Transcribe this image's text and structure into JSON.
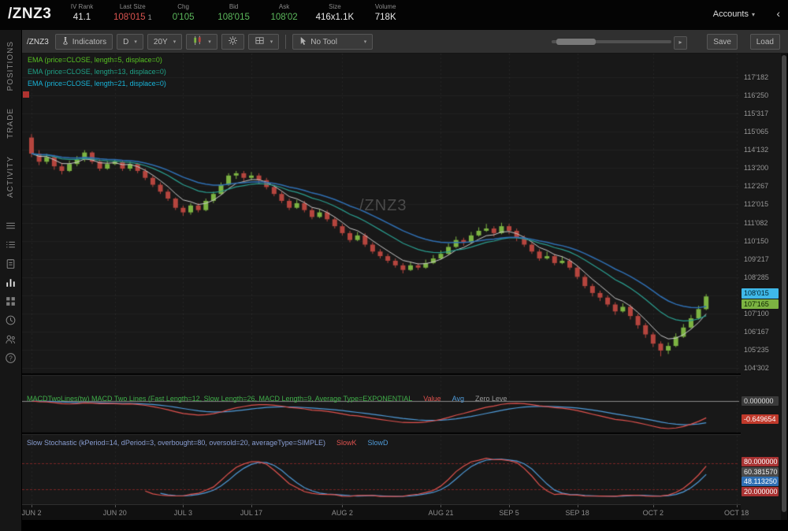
{
  "header": {
    "symbol": "/ZNZ3",
    "stats": [
      {
        "label": "IV Rank",
        "value": "41.1",
        "color": "white"
      },
      {
        "label": "Last Size",
        "value": "108'015",
        "suffix": "1",
        "color": "red"
      },
      {
        "label": "Chg",
        "value": "0'105",
        "color": "green"
      },
      {
        "label": "Bid",
        "value": "108'015",
        "color": "green"
      },
      {
        "label": "Ask",
        "value": "108'02",
        "color": "green"
      },
      {
        "label": "Size",
        "value": "416x1.1K",
        "color": "white"
      },
      {
        "label": "Volume",
        "value": "718K",
        "color": "white"
      }
    ],
    "accounts_label": "Accounts"
  },
  "toolbar": {
    "symbol_chip": "/ZNZ3",
    "indicators_label": "Indicators",
    "timeframe_value": "D",
    "range_value": "20Y",
    "tool_value": "No Tool",
    "save_label": "Save",
    "load_label": "Load"
  },
  "sidebar": {
    "tabs": [
      "POSITIONS",
      "TRADE",
      "ACTIVITY"
    ],
    "icons": [
      {
        "name": "menu-rows-icon"
      },
      {
        "name": "watchlist-icon"
      },
      {
        "name": "orders-clipboard-icon"
      },
      {
        "name": "chart-icon",
        "active": true
      },
      {
        "name": "apps-grid-icon"
      },
      {
        "name": "history-clock-icon"
      },
      {
        "name": "followers-users-icon"
      },
      {
        "name": "help-icon"
      }
    ]
  },
  "chart": {
    "watermark": "/ZNZ3",
    "ema_labels": [
      {
        "text": "EMA (price=CLOSE, length=5, displace=0)",
        "color": "#56c022"
      },
      {
        "text": "EMA (price=CLOSE, length=13, displace=0)",
        "color": "#1fa187"
      },
      {
        "text": "EMA (price=CLOSE, length=21, displace=0)",
        "color": "#18b4d8"
      }
    ],
    "price_axis_labels": [
      "117'182",
      "116'250",
      "115'317",
      "115'065",
      "114'132",
      "113'200",
      "112'267",
      "112'015",
      "111'082",
      "110'150",
      "109'217",
      "108'285",
      "107'100",
      "106'167",
      "105'235",
      "104'302"
    ],
    "last_price_box": {
      "text": "108'015",
      "bg": "#3fb8e8",
      "fg": "#00222e"
    },
    "close_price_box": {
      "text": "107'165",
      "bg": "#7cb342",
      "fg": "#0c2200"
    },
    "time_axis": [
      {
        "label": "JUN 2",
        "day": 0
      },
      {
        "label": "JUN 20",
        "day": 11
      },
      {
        "label": "JUL 3",
        "day": 20
      },
      {
        "label": "JUL 17",
        "day": 29
      },
      {
        "label": "AUG 2",
        "day": 41
      },
      {
        "label": "AUG 21",
        "day": 54
      },
      {
        "label": "SEP 5",
        "day": 63
      },
      {
        "label": "SEP 18",
        "day": 72
      },
      {
        "label": "OCT 2",
        "day": 82
      },
      {
        "label": "OCT 18",
        "day": 93
      }
    ]
  },
  "macd": {
    "label": "MACDTwoLines(tw) MACD Two Lines (Fast Length=12, Slow Length=26, MACD Length=9, Average Type=EXPONENTIAL",
    "legend": [
      {
        "text": "Value",
        "color": "#e0524e"
      },
      {
        "text": "Avg",
        "color": "#4f9bd9"
      },
      {
        "text": "Zero Leve",
        "color": "#9a9a9a"
      }
    ],
    "zero_box": "0.000000",
    "value_box": "-0.649654"
  },
  "stochastic": {
    "label": "Slow Stochastic (kPeriod=14, dPeriod=3, overbought=80, oversold=20, averageType=SIMPLE)",
    "legend": [
      {
        "text": "SlowK",
        "color": "#e0524e"
      },
      {
        "text": "SlowD",
        "color": "#4f9bd9"
      }
    ],
    "boxes": [
      {
        "text": "80.000000",
        "bg": "#a83232",
        "fg": "#ffffff"
      },
      {
        "text": "60.381570",
        "bg": "#4a4a4a",
        "fg": "#eeeeee"
      },
      {
        "text": "48.113250",
        "bg": "#2f6fb3",
        "fg": "#ffffff"
      },
      {
        "text": "20.000000",
        "bg": "#a83232",
        "fg": "#ffffff"
      }
    ]
  },
  "chart_data": {
    "type": "candlestick",
    "symbol": "/ZNZ3",
    "timeframe": "D",
    "price_min": 104.944,
    "price_max": 117.57,
    "up_color": "#7cb342",
    "down_color": "#b5453e",
    "indicators": {
      "ema": {
        "lengths": [
          5,
          13,
          21
        ],
        "colors": [
          "#c9c9c9",
          "#2a9d8f",
          "#2f6fb3"
        ]
      },
      "macd": {
        "fast": 12,
        "slow": 26,
        "signal": 9,
        "value_color": "#e0524e",
        "avg_color": "#4f9bd9"
      },
      "stochastic": {
        "k_period": 14,
        "d_period": 3,
        "overbought": 80,
        "oversold": 20,
        "k_color": "#e0524e",
        "d_color": "#4f9bd9"
      }
    },
    "candles": [
      [
        114.95,
        115.1,
        114.1,
        114.25
      ],
      [
        114.25,
        114.4,
        113.75,
        113.9
      ],
      [
        113.9,
        114.25,
        113.8,
        114.1
      ],
      [
        114.1,
        114.2,
        113.55,
        113.7
      ],
      [
        113.7,
        113.85,
        113.35,
        113.5
      ],
      [
        113.5,
        113.95,
        113.45,
        113.8
      ],
      [
        113.8,
        114.15,
        113.7,
        114.0
      ],
      [
        114.0,
        114.4,
        113.9,
        114.3
      ],
      [
        114.3,
        114.35,
        113.8,
        113.9
      ],
      [
        113.9,
        114.0,
        113.5,
        113.6
      ],
      [
        113.6,
        113.95,
        113.55,
        113.8
      ],
      [
        113.8,
        114.0,
        113.75,
        113.9
      ],
      [
        113.9,
        113.95,
        113.5,
        113.6
      ],
      [
        113.6,
        113.9,
        113.5,
        113.8
      ],
      [
        113.8,
        113.85,
        113.4,
        113.5
      ],
      [
        113.5,
        113.6,
        113.1,
        113.2
      ],
      [
        113.2,
        113.3,
        112.8,
        112.9
      ],
      [
        112.9,
        113.0,
        112.5,
        112.6
      ],
      [
        112.6,
        112.7,
        112.2,
        112.3
      ],
      [
        112.3,
        112.35,
        111.8,
        111.9
      ],
      [
        111.9,
        112.0,
        111.55,
        111.7
      ],
      [
        111.7,
        112.1,
        111.6,
        112.0
      ],
      [
        112.0,
        112.1,
        111.7,
        111.8
      ],
      [
        111.8,
        112.3,
        111.75,
        112.2
      ],
      [
        112.2,
        112.6,
        112.1,
        112.5
      ],
      [
        112.5,
        113.0,
        112.45,
        112.9
      ],
      [
        112.9,
        113.4,
        112.85,
        113.3
      ],
      [
        113.3,
        113.5,
        113.15,
        113.4
      ],
      [
        113.4,
        113.5,
        113.05,
        113.2
      ],
      [
        113.2,
        113.45,
        113.1,
        113.3
      ],
      [
        113.3,
        113.4,
        112.95,
        113.1
      ],
      [
        113.1,
        113.2,
        112.7,
        112.8
      ],
      [
        112.8,
        112.9,
        112.4,
        112.5
      ],
      [
        112.5,
        112.6,
        112.1,
        112.2
      ],
      [
        112.2,
        112.3,
        111.8,
        111.9
      ],
      [
        111.9,
        112.25,
        111.85,
        112.1
      ],
      [
        112.1,
        112.2,
        111.7,
        111.8
      ],
      [
        111.8,
        111.9,
        111.4,
        111.5
      ],
      [
        111.5,
        111.85,
        111.45,
        111.7
      ],
      [
        111.7,
        111.8,
        111.3,
        111.4
      ],
      [
        111.4,
        111.5,
        111.0,
        111.1
      ],
      [
        111.1,
        111.2,
        110.7,
        110.8
      ],
      [
        110.8,
        110.9,
        110.4,
        110.5
      ],
      [
        110.5,
        110.85,
        110.45,
        110.7
      ],
      [
        110.7,
        110.8,
        110.2,
        110.3
      ],
      [
        110.3,
        110.4,
        109.9,
        110.0
      ],
      [
        110.0,
        110.1,
        109.7,
        109.8
      ],
      [
        109.8,
        109.9,
        109.5,
        109.6
      ],
      [
        109.6,
        109.7,
        109.3,
        109.4
      ],
      [
        109.4,
        109.5,
        109.05,
        109.2
      ],
      [
        109.2,
        109.55,
        109.15,
        109.4
      ],
      [
        109.4,
        109.5,
        109.2,
        109.3
      ],
      [
        109.3,
        109.65,
        109.25,
        109.5
      ],
      [
        109.5,
        109.85,
        109.45,
        109.7
      ],
      [
        109.7,
        110.05,
        109.65,
        109.9
      ],
      [
        109.9,
        110.35,
        109.85,
        110.2
      ],
      [
        110.2,
        110.65,
        110.15,
        110.5
      ],
      [
        110.5,
        110.6,
        110.25,
        110.4
      ],
      [
        110.4,
        110.85,
        110.35,
        110.7
      ],
      [
        110.7,
        111.05,
        110.65,
        110.9
      ],
      [
        110.9,
        111.2,
        110.85,
        111.0
      ],
      [
        111.0,
        111.1,
        110.65,
        110.8
      ],
      [
        110.8,
        111.25,
        110.75,
        111.1
      ],
      [
        111.1,
        111.2,
        110.75,
        110.9
      ],
      [
        110.9,
        111.0,
        110.45,
        110.6
      ],
      [
        110.6,
        110.7,
        110.2,
        110.3
      ],
      [
        110.3,
        110.4,
        109.9,
        110.0
      ],
      [
        110.0,
        110.1,
        109.6,
        109.7
      ],
      [
        109.7,
        110.0,
        109.65,
        109.8
      ],
      [
        109.8,
        109.9,
        109.4,
        109.5
      ],
      [
        109.5,
        109.8,
        109.45,
        109.6
      ],
      [
        109.6,
        109.7,
        109.2,
        109.3
      ],
      [
        109.3,
        109.4,
        108.8,
        108.9
      ],
      [
        108.9,
        109.0,
        108.4,
        108.5
      ],
      [
        108.5,
        108.6,
        108.05,
        108.2
      ],
      [
        108.2,
        108.3,
        107.85,
        108.0
      ],
      [
        108.0,
        108.1,
        107.6,
        107.7
      ],
      [
        107.7,
        107.8,
        107.25,
        107.4
      ],
      [
        107.4,
        107.75,
        107.35,
        107.6
      ],
      [
        107.6,
        107.7,
        107.05,
        107.2
      ],
      [
        107.2,
        107.3,
        106.65,
        106.8
      ],
      [
        106.8,
        106.9,
        106.25,
        106.4
      ],
      [
        106.4,
        106.5,
        105.85,
        106.0
      ],
      [
        106.0,
        106.1,
        105.45,
        105.7
      ],
      [
        105.7,
        106.05,
        105.55,
        105.9
      ],
      [
        105.9,
        106.45,
        105.85,
        106.3
      ],
      [
        106.3,
        106.85,
        106.25,
        106.7
      ],
      [
        106.7,
        107.25,
        106.65,
        107.1
      ],
      [
        107.1,
        107.65,
        107.05,
        107.5
      ],
      [
        107.5,
        108.15,
        107.45,
        108.05
      ]
    ]
  }
}
